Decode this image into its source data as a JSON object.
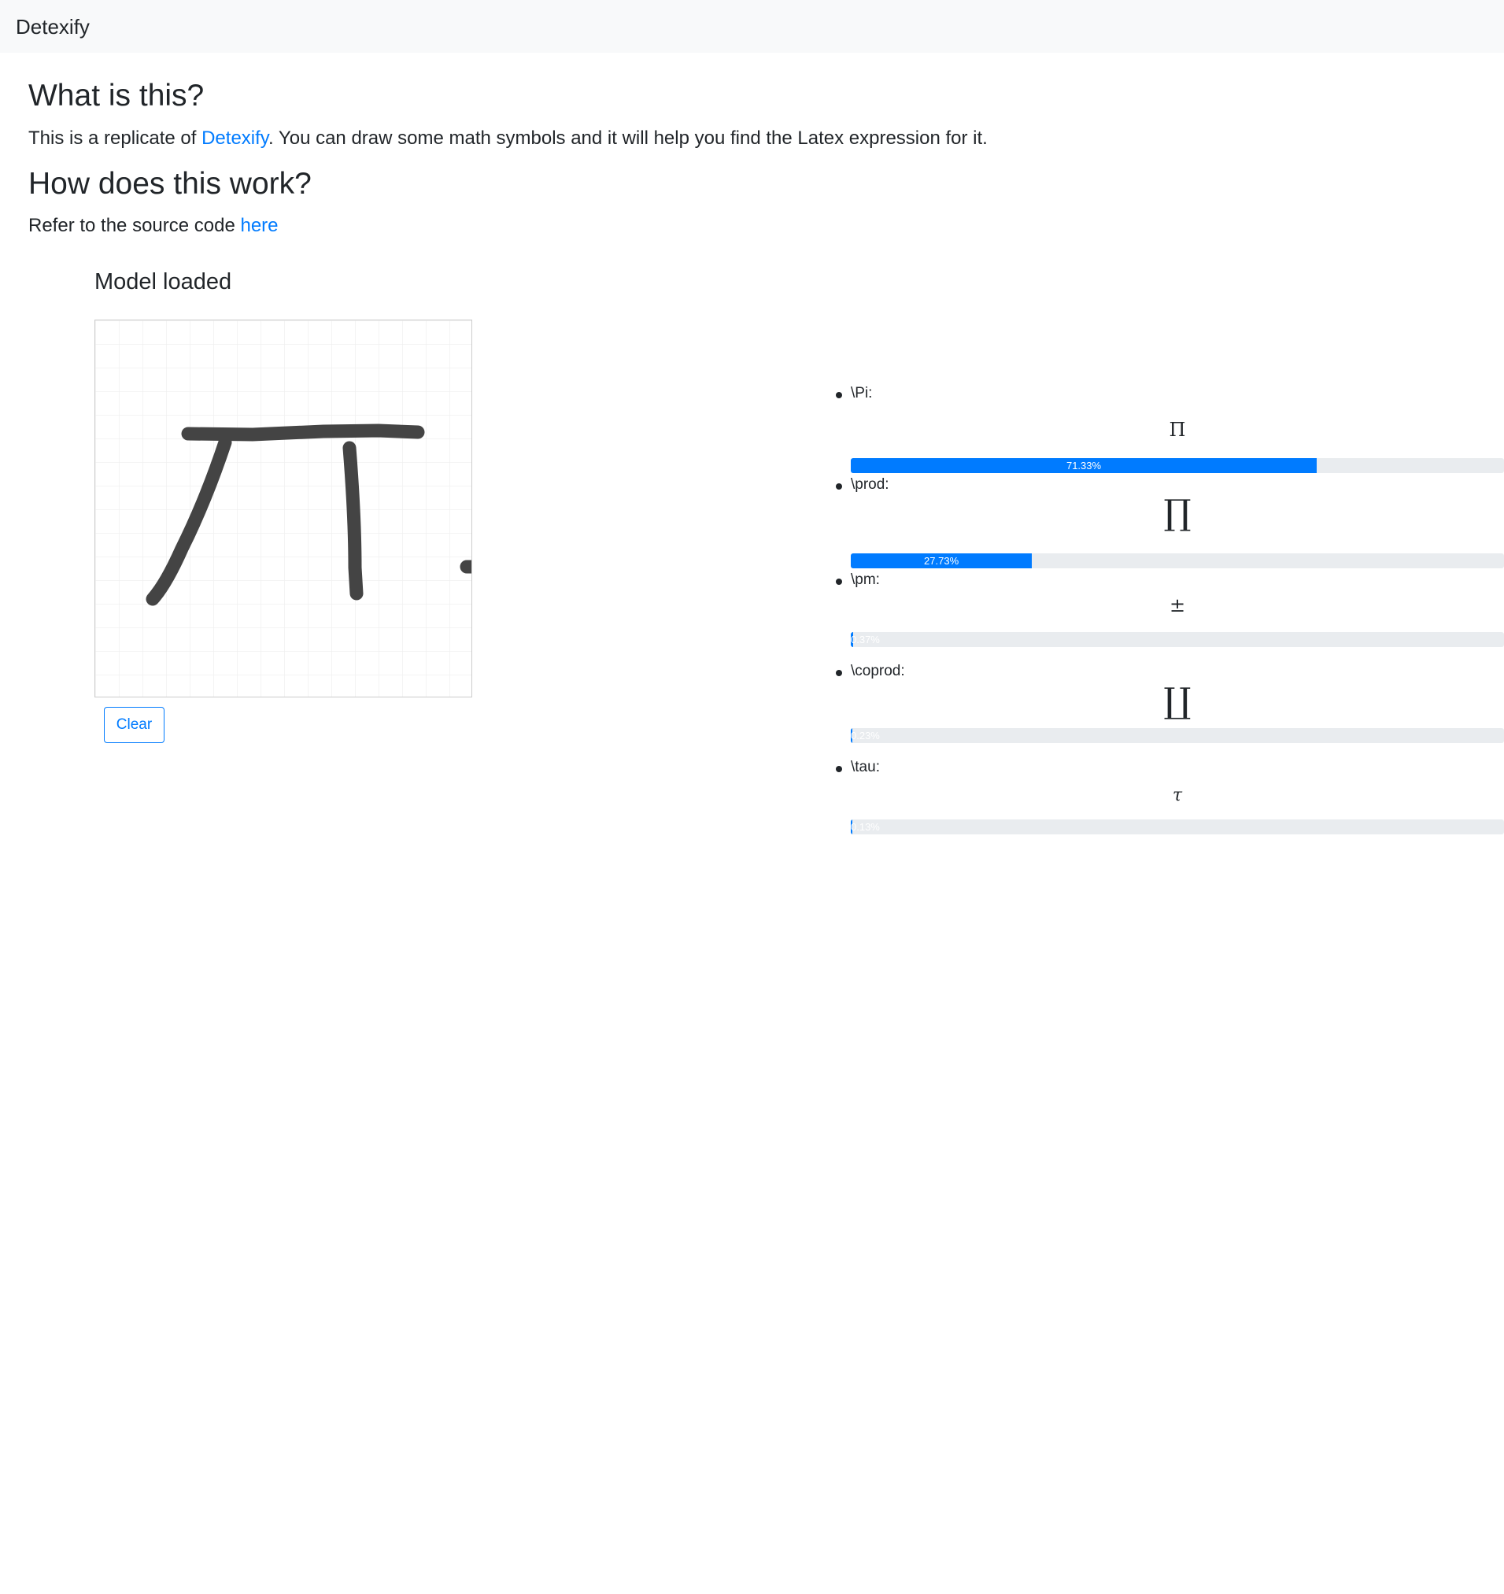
{
  "navbar": {
    "brand": "Detexify"
  },
  "about": {
    "heading": "What is this?",
    "text_before": "This is a replicate of ",
    "link_text": "Detexify",
    "text_after": ". You can draw some math symbols and it will help you find the Latex expression for it."
  },
  "how": {
    "heading": "How does this work?",
    "text_before": "Refer to the source code ",
    "link_text": "here"
  },
  "status": "Model loaded",
  "clear_button": "Clear",
  "predictions": [
    {
      "label": "\\Pi:",
      "symbol": "Π",
      "percent_label": "71.33%",
      "percent": 71.33
    },
    {
      "label": "\\prod:",
      "symbol": "∏",
      "percent_label": "27.73%",
      "percent": 27.73
    },
    {
      "label": "\\pm:",
      "symbol": "±",
      "percent_label": "0.37%",
      "percent": 0.37
    },
    {
      "label": "\\coprod:",
      "symbol": "∐",
      "percent_label": "0.23%",
      "percent": 0.23
    },
    {
      "label": "\\tau:",
      "symbol": "τ",
      "percent_label": "0.13%",
      "percent": 0.13
    }
  ],
  "colors": {
    "primary": "#007bff",
    "navbar_bg": "#f8f9fa",
    "progress_track": "#e9ecef",
    "ink": "#444444"
  }
}
